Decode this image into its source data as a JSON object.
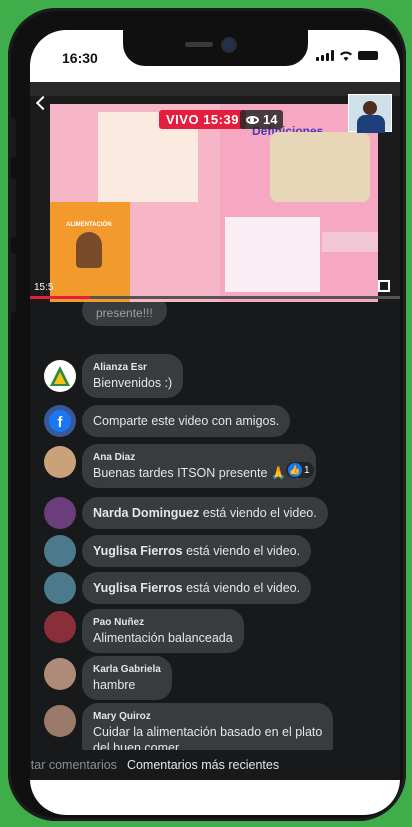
{
  "status_bar": {
    "time": "16:30"
  },
  "video": {
    "live_label": "VIVO",
    "live_duration": "15:39",
    "viewer_count": "14",
    "elapsed": "15:5",
    "slide": {
      "title": "Definiciones",
      "section_label": "ALIMENTACIÓN"
    }
  },
  "comments": [
    {
      "id": "partial",
      "text": "presente!!!"
    },
    {
      "id": "alianza",
      "author": "Alianza Esr",
      "text": "Bienvenidos :)",
      "avatar_color": "#ffffff"
    },
    {
      "id": "share",
      "text": "Comparte este video con amigos."
    },
    {
      "id": "ana",
      "author": "Ana Diaz",
      "text": "Buenas tardes ITSON presente 🙏 💙",
      "reaction_count": "1"
    },
    {
      "id": "narda",
      "author": "Narda Dominguez",
      "text": "está viendo el video."
    },
    {
      "id": "yuglisa1",
      "author": "Yuglisa Fierros",
      "text": "está viendo el video."
    },
    {
      "id": "yuglisa2",
      "author": "Yuglisa Fierros",
      "text": "está viendo el video."
    },
    {
      "id": "pao",
      "author": "Pao Nuñez",
      "text": "Alimentación balanceada"
    },
    {
      "id": "karla",
      "author": "Karla Gabriela",
      "text": "hambre"
    },
    {
      "id": "mary",
      "author": "Mary Quiroz",
      "text_line1": "Cuidar la alimentación  basado en el plato",
      "text_line2": "del buen comer"
    }
  ],
  "tabs": {
    "first": "ltar comentarios",
    "second": "Comentarios más recientes"
  },
  "colors": {
    "accent_green": "#3fae4a",
    "live_red": "#e41e3f",
    "facebook_blue": "#1877f2",
    "chat_bg": "#18191a"
  }
}
